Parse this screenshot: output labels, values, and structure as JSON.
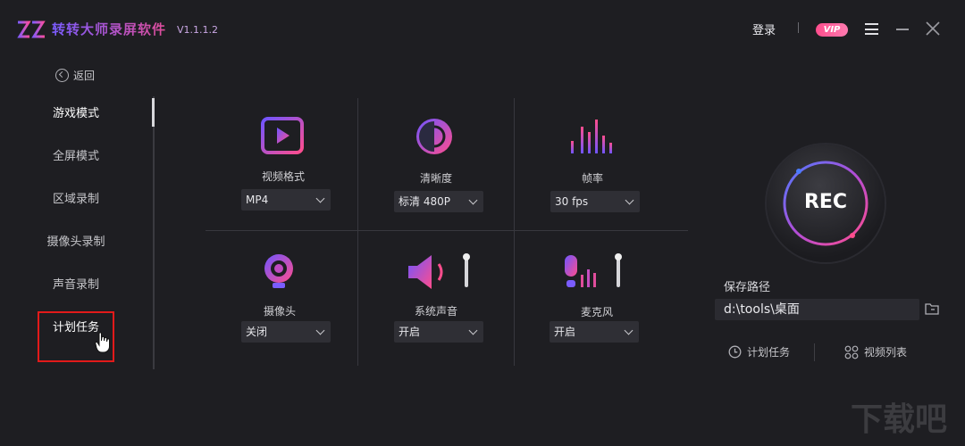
{
  "app": {
    "title": "转转大师录屏软件",
    "version": "V1.1.1.2",
    "login": "登录",
    "vip": "VIP"
  },
  "sidebar": {
    "back": "返回",
    "items": [
      {
        "label": "游戏模式",
        "active": true
      },
      {
        "label": "全屏模式",
        "active": false
      },
      {
        "label": "区域录制",
        "active": false
      },
      {
        "label": "摄像头录制",
        "active": false
      },
      {
        "label": "声音录制",
        "active": false
      },
      {
        "label": "计划任务",
        "active": false
      }
    ]
  },
  "settings": {
    "video_format": {
      "label": "视频格式",
      "value": "MP4"
    },
    "clarity": {
      "label": "清晰度",
      "value": "标清 480P"
    },
    "frame_rate": {
      "label": "帧率",
      "value": "30 fps"
    },
    "camera": {
      "label": "摄像头",
      "value": "关闭"
    },
    "system_sound": {
      "label": "系统声音",
      "value": "开启"
    },
    "microphone": {
      "label": "麦克风",
      "value": "开启"
    }
  },
  "recorder": {
    "rec": "REC",
    "save_path_label": "保存路径",
    "save_path": "d:\\tools\\桌面",
    "scheduled_task": "计划任务",
    "video_list": "视频列表"
  },
  "watermark": "下载吧",
  "colors": {
    "accent_purple": "#7a5cff",
    "accent_pink": "#e04d9b",
    "highlight_box": "#e21a1a",
    "background": "#1e1e22"
  }
}
